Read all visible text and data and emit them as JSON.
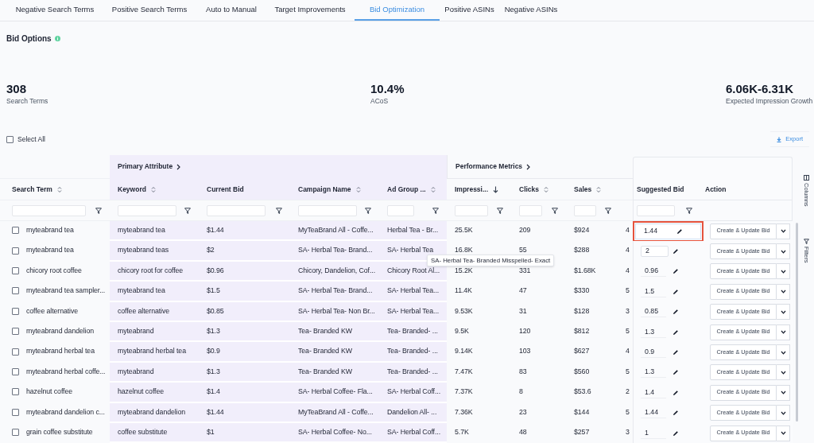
{
  "tabs": [
    {
      "label": "Negative Search Terms",
      "selected": false
    },
    {
      "label": "Positive Search Terms",
      "selected": false
    },
    {
      "label": "Auto to Manual",
      "selected": false
    },
    {
      "label": "Target Improvements",
      "selected": false
    },
    {
      "label": "Bid Optimization",
      "selected": true
    },
    {
      "label": "Positive ASINs",
      "selected": false
    },
    {
      "label": "Negative ASINs",
      "selected": false
    }
  ],
  "section_title": "Bid Options",
  "stats": [
    {
      "value": "308",
      "label": "Search Terms"
    },
    {
      "value": "10.4%",
      "label": "ACoS"
    },
    {
      "value": "6.06K-6.31K",
      "label": "Expected Impression Growth"
    }
  ],
  "select_all": {
    "label": "Select All",
    "checked": false
  },
  "export_button": "Export",
  "table": {
    "column_groups": [
      {
        "label": "Primary Attribute"
      },
      {
        "label": "Performance Metrics"
      }
    ],
    "columns": [
      {
        "label": "Search Term",
        "sortable": true,
        "sorted_descending": false,
        "filterable": true
      },
      {
        "label": "Keyword",
        "sortable": true,
        "sorted_descending": false,
        "filterable": true
      },
      {
        "label": "Current Bid",
        "sortable": false,
        "filterable": true
      },
      {
        "label": "Campaign Name",
        "sortable": true,
        "sorted_descending": false,
        "filterable": true
      },
      {
        "label": "Ad Group ...",
        "sortable": true,
        "sorted_descending": false,
        "filterable": true
      },
      {
        "label": "Impressi...",
        "sortable": true,
        "sorted_descending": true,
        "filterable": true
      },
      {
        "label": "Clicks",
        "sortable": true,
        "sorted_descending": false,
        "filterable": true
      },
      {
        "label": "Sales",
        "sortable": true,
        "sorted_descending": false,
        "filterable": true
      },
      {
        "label": "Suggested Bid",
        "sortable": false,
        "filterable": true
      },
      {
        "label": "Action",
        "sortable": false,
        "filterable": false
      }
    ],
    "rows": [
      {
        "selected": false,
        "search_term": "myteabrand tea",
        "keyword": "myteabrand tea",
        "current_bid": "$1.44",
        "campaign_name": "MyTeaBrand All - Coffe...",
        "ad_group": "Herbal Tea - Br...",
        "impressions": "25.5K",
        "clicks": "209",
        "sales": "$924",
        "column_9": "4",
        "suggested_bid": {
          "value": "1.44",
          "kind": "highlighted"
        },
        "action": "Create & Update Bid"
      },
      {
        "selected": false,
        "search_term": "myteabrand tea",
        "keyword": "myteabrand teas",
        "current_bid": "$2",
        "campaign_name": "SA- Herbal Tea- Brand...",
        "ad_group": "SA- Herbal Tea",
        "impressions": "16.8K",
        "clicks": "55",
        "sales": "$288",
        "column_9": "4",
        "suggested_bid": {
          "value": "2",
          "kind": "boxed"
        },
        "action": "Create & Update Bid"
      },
      {
        "selected": false,
        "search_term": "chicory root coffee",
        "keyword": "chicory root for coffee",
        "current_bid": "$0.96",
        "campaign_name": "Chicory, Dandelion, Cof...",
        "ad_group": "Chicory Root Al...",
        "impressions": "15.2K",
        "clicks": "331",
        "sales": "$1.68K",
        "column_9": "4",
        "suggested_bid": {
          "value": "0.96",
          "kind": "plain"
        },
        "action": "Create & Update Bid"
      },
      {
        "selected": false,
        "search_term": "myteabrand tea sampler...",
        "keyword": "myteabrand tea",
        "current_bid": "$1.5",
        "campaign_name": "SA- Herbal Tea- Brand...",
        "ad_group": "SA- Herbal Tea...",
        "impressions": "11.4K",
        "clicks": "47",
        "sales": "$330",
        "column_9": "5",
        "suggested_bid": {
          "value": "1.5",
          "kind": "plain"
        },
        "action": "Create & Update Bid"
      },
      {
        "selected": false,
        "search_term": "coffee alternative",
        "keyword": "coffee alternative",
        "current_bid": "$0.85",
        "campaign_name": "SA- Herbal Tea- Non Br...",
        "ad_group": "SA- Herbal Tea...",
        "impressions": "9.53K",
        "clicks": "31",
        "sales": "$128",
        "column_9": "3",
        "suggested_bid": {
          "value": "0.85",
          "kind": "plain"
        },
        "action": "Create & Update Bid"
      },
      {
        "selected": false,
        "search_term": "myteabrand dandelion",
        "keyword": "myteabrand",
        "current_bid": "$1.3",
        "campaign_name": "Tea- Branded KW",
        "ad_group": "Tea- Branded- ...",
        "impressions": "9.5K",
        "clicks": "120",
        "sales": "$812",
        "column_9": "5",
        "suggested_bid": {
          "value": "1.3",
          "kind": "plain"
        },
        "action": "Create & Update Bid"
      },
      {
        "selected": false,
        "search_term": "myteabrand herbal tea",
        "keyword": "myteabrand herbal tea",
        "current_bid": "$0.9",
        "campaign_name": "Tea- Branded KW",
        "ad_group": "Tea- Branded- ...",
        "impressions": "9.14K",
        "clicks": "103",
        "sales": "$627",
        "column_9": "4",
        "suggested_bid": {
          "value": "0.9",
          "kind": "plain"
        },
        "action": "Create & Update Bid"
      },
      {
        "selected": false,
        "search_term": "myteabrand herbal coffe...",
        "keyword": "myteabrand",
        "current_bid": "$1.3",
        "campaign_name": "Tea- Branded KW",
        "ad_group": "Tea- Branded- ...",
        "impressions": "7.47K",
        "clicks": "83",
        "sales": "$560",
        "column_9": "5",
        "suggested_bid": {
          "value": "1.3",
          "kind": "plain"
        },
        "action": "Create & Update Bid"
      },
      {
        "selected": false,
        "search_term": "hazelnut coffee",
        "keyword": "hazelnut coffee",
        "current_bid": "$1.4",
        "campaign_name": "SA- Herbal Coffee- Fla...",
        "ad_group": "SA- Herbal Coff...",
        "impressions": "7.37K",
        "clicks": "8",
        "sales": "$53.6",
        "column_9": "2",
        "suggested_bid": {
          "value": "1.4",
          "kind": "plain"
        },
        "action": "Create & Update Bid"
      },
      {
        "selected": false,
        "search_term": "myteabrand dandelion c...",
        "keyword": "myteabrand dandelion",
        "current_bid": "$1.44",
        "campaign_name": "MyTeaBrand All - Coffe...",
        "ad_group": "Dandelion All- ...",
        "impressions": "7.36K",
        "clicks": "23",
        "sales": "$144",
        "column_9": "5",
        "suggested_bid": {
          "value": "1.44",
          "kind": "plain"
        },
        "action": "Create & Update Bid"
      },
      {
        "selected": false,
        "search_term": "grain coffee substitute",
        "keyword": "coffee substitute",
        "current_bid": "$1",
        "campaign_name": "SA- Herbal Coffee- No...",
        "ad_group": "SA- Herbal Coff...",
        "impressions": "5.7K",
        "clicks": "48",
        "sales": "$257",
        "column_9": "3",
        "suggested_bid": {
          "value": "1",
          "kind": "plain"
        },
        "action": "Create & Update Bid"
      }
    ],
    "tooltip": {
      "text": "SA- Herbal Tea- Branded Misspelled- Exact"
    }
  },
  "side_panel": [
    {
      "label": "Columns",
      "kind": "columns"
    },
    {
      "label": "Filters",
      "kind": "filters"
    }
  ]
}
